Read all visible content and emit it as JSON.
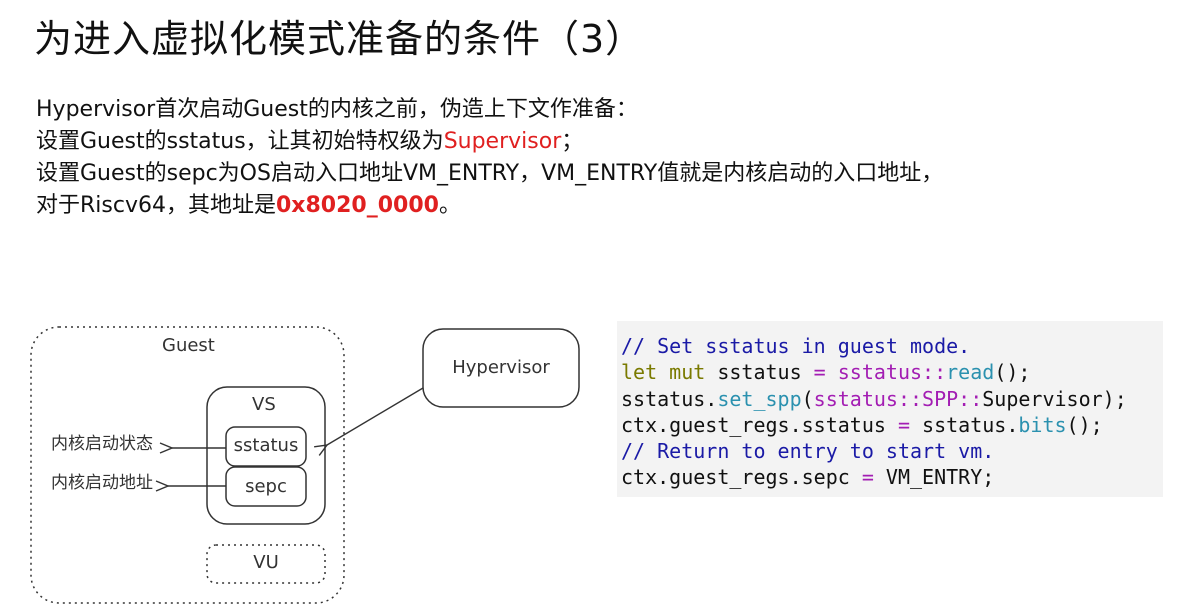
{
  "title": "为进入虚拟化模式准备的条件（3）",
  "paragraph": {
    "line1": "Hypervisor首次启动Guest的内核之前，伪造上下文作准备：",
    "line2_prefix": "设置Guest的sstatus，让其初始特权级为",
    "line2_highlight": "Supervisor",
    "line2_suffix": "；",
    "line3": "设置Guest的sepc为OS启动入口地址VM_ENTRY，VM_ENTRY值就是内核启动的入口地址，",
    "line4_prefix": "对于Riscv64，其地址是",
    "line4_highlight": "0x8020_0000",
    "line4_suffix": "。"
  },
  "diagram": {
    "guest_label": "Guest",
    "vs_label": "VS",
    "sstatus_label": "sstatus",
    "sepc_label": "sepc",
    "vu_label": "VU",
    "hypervisor_label": "Hypervisor",
    "kernel_state_label": "内核启动状态",
    "kernel_addr_label": "内核启动地址"
  },
  "code": {
    "l1_comment": "// Set sstatus in guest mode.",
    "l2_kw": "let mut",
    "l2_var": " sstatus ",
    "l2_eq": "=",
    "l2_path": " sstatus::",
    "l2_fn": "read",
    "l2_end": "();",
    "l3_a": "sstatus.",
    "l3_fn": "set_spp",
    "l3_b": "(",
    "l3_path": "sstatus::SPP::",
    "l3_c": "Supervisor);",
    "l4_a": "ctx.guest_regs.sstatus ",
    "l4_eq": "=",
    "l4_b": " sstatus.",
    "l4_fn": "bits",
    "l4_c": "();",
    "l5_comment": "// Return to entry to start vm.",
    "l6_a": "ctx.guest_regs.sepc ",
    "l6_eq": "=",
    "l6_b": " VM_ENTRY;"
  }
}
